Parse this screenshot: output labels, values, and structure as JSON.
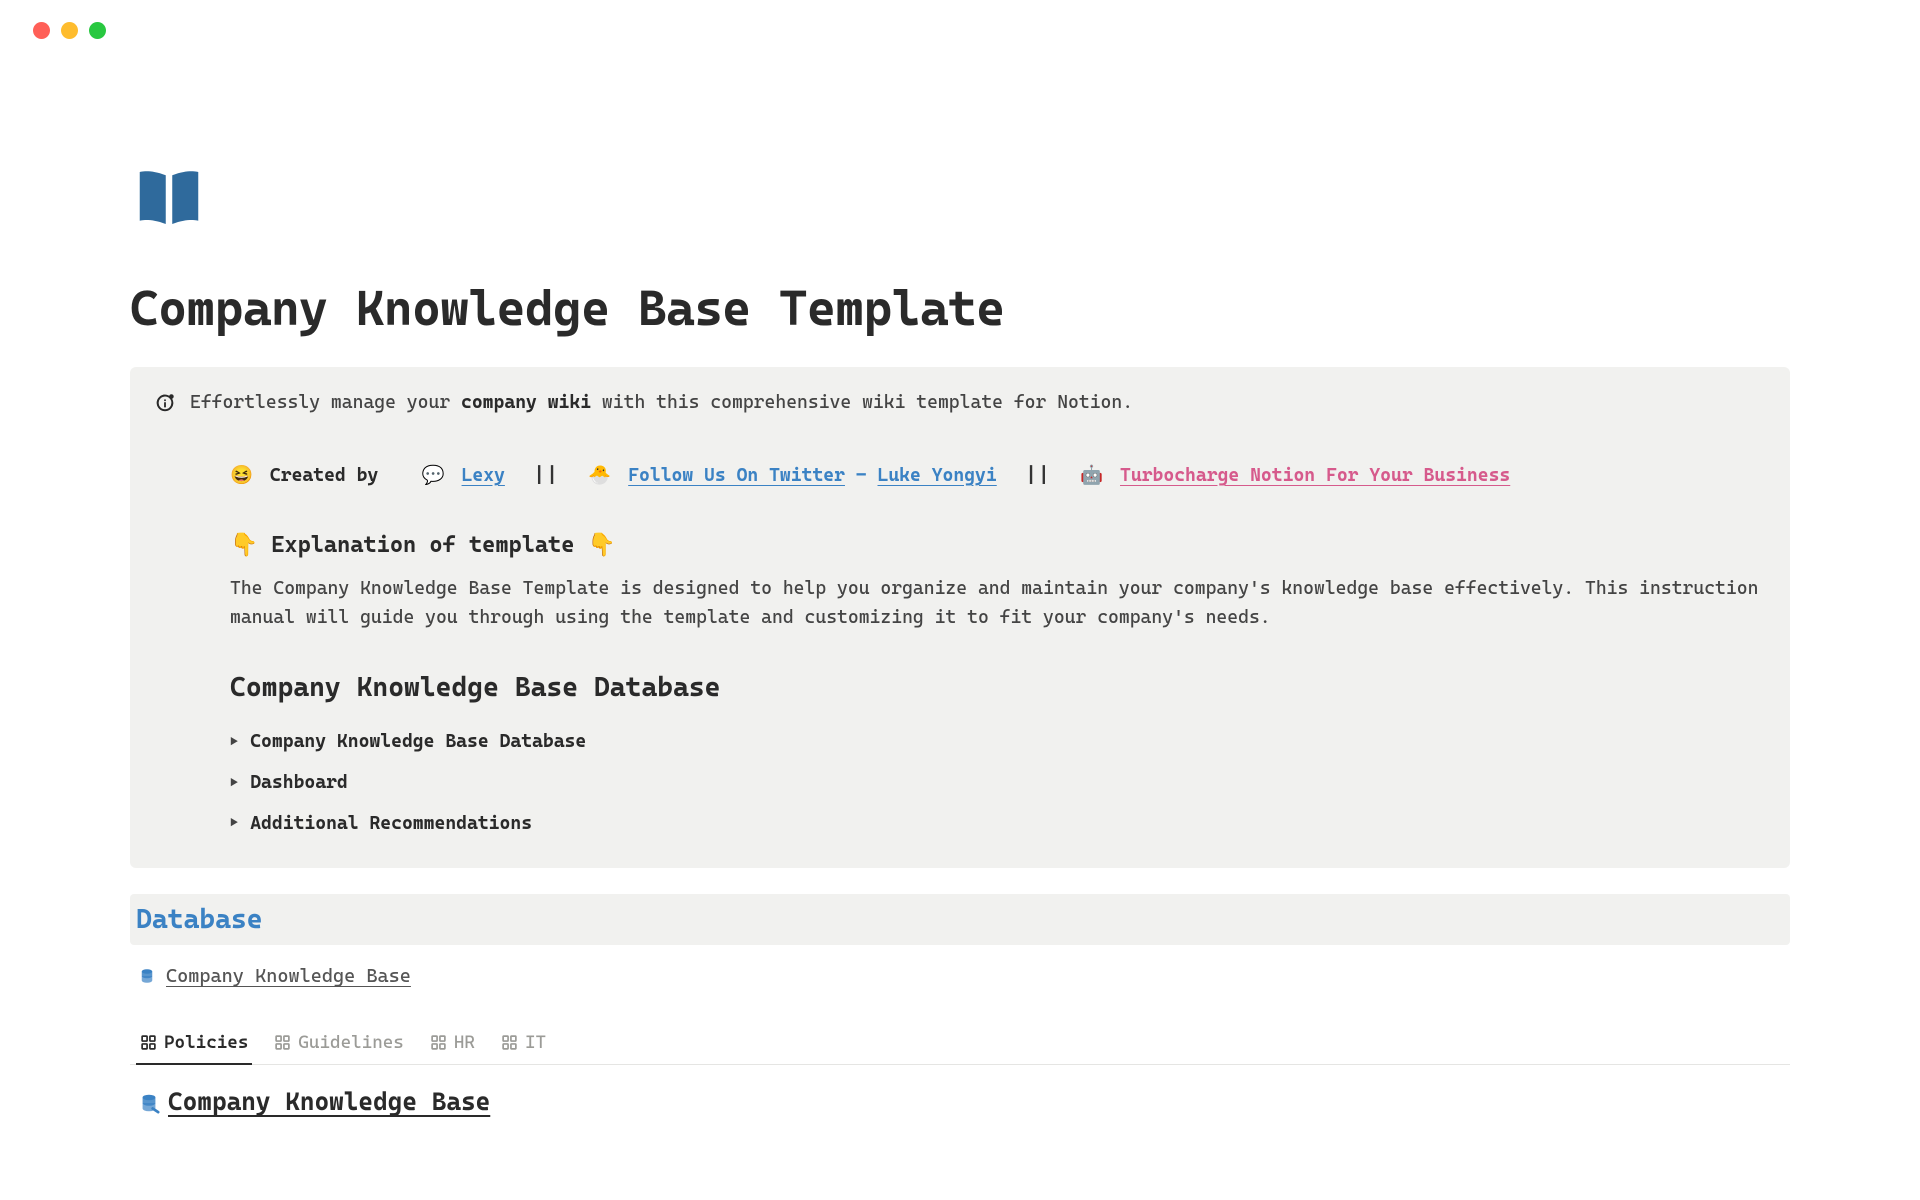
{
  "page_title": "Company Knowledge Base Template",
  "callout": {
    "intro_prefix": "Effortlessly manage your ",
    "intro_bold": "company wiki",
    "intro_suffix": " with this comprehensive wiki template for Notion."
  },
  "credits": {
    "created_emoji": "😆",
    "created_by": "Created by",
    "lexy_emoji": "💬",
    "lexy": "Lexy",
    "sep": "||",
    "twitter_emoji": "🐣",
    "follow": "Follow Us On Twitter",
    "dash": " - ",
    "luke": "Luke Yongyi",
    "robot_emoji": "🤖",
    "turbo": "Turbocharge Notion For Your Business"
  },
  "explanation": {
    "heading_pre_emoji": "👇",
    "heading_text": " Explanation of template ",
    "heading_post_emoji": "👇",
    "body": "The Company Knowledge Base Template is designed to help you organize and maintain your company's knowledge base effectively. This instruction manual will guide you through using the template and customizing it to fit your company's needs."
  },
  "subheading": "Company Knowledge Base Database",
  "toggles": [
    "Company Knowledge Base Database",
    "Dashboard",
    "Additional Recommendations"
  ],
  "database": {
    "heading": "Database",
    "link_label": "Company Knowledge Base",
    "group_title": "Company Knowledge Base"
  },
  "tabs": [
    {
      "label": "Policies",
      "active": true
    },
    {
      "label": "Guidelines",
      "active": false
    },
    {
      "label": "HR",
      "active": false
    },
    {
      "label": "IT",
      "active": false
    }
  ]
}
